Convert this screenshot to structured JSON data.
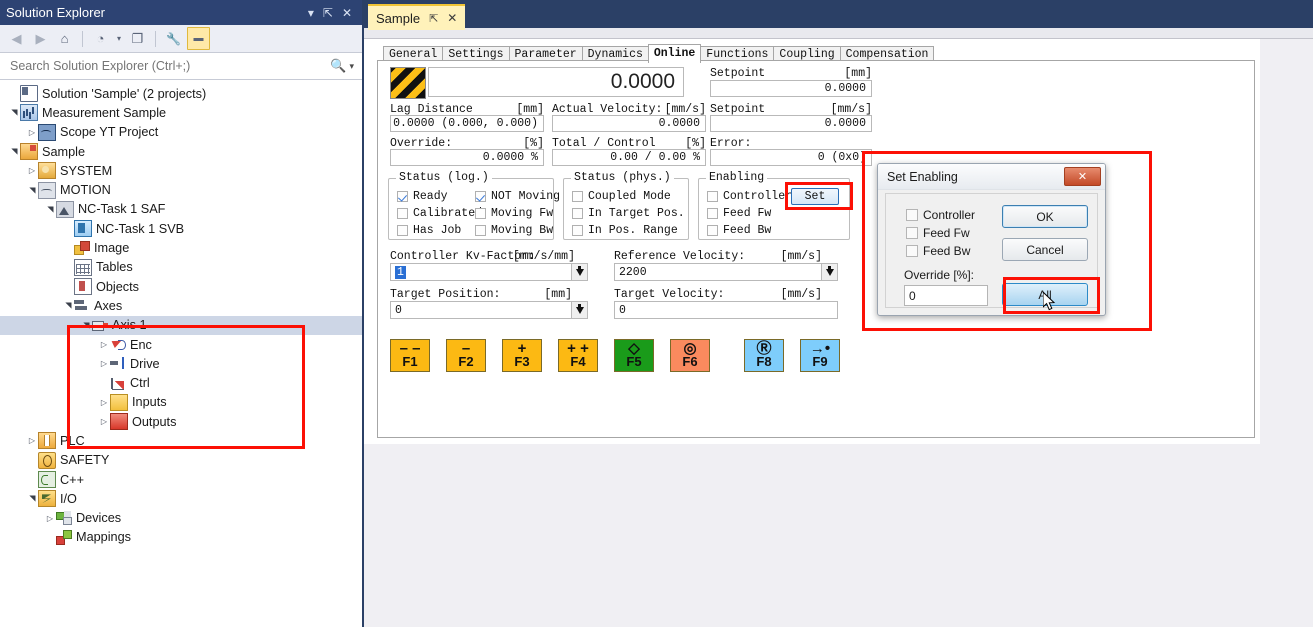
{
  "solution_explorer": {
    "title": "Solution Explorer",
    "titlebar_buttons": [
      {
        "name": "dropdown",
        "glyph": "▾"
      },
      {
        "name": "pin",
        "glyph": "⇱"
      },
      {
        "name": "close",
        "glyph": "✕"
      }
    ],
    "toolbar": [
      {
        "name": "back-icon",
        "glyph": "◀"
      },
      {
        "name": "forward-icon",
        "glyph": "▶"
      },
      {
        "name": "home-icon",
        "glyph": "⌂"
      },
      {
        "name": "pending-changes-icon",
        "glyph": "◔"
      },
      {
        "name": "dropdown-icon",
        "glyph": "▾"
      },
      {
        "name": "copy-icon",
        "glyph": "❐"
      },
      {
        "name": "properties-icon",
        "glyph": "🔧"
      },
      {
        "name": "collapse-icon",
        "glyph": "▬"
      }
    ],
    "search": {
      "placeholder": "Search Solution Explorer (Ctrl+;)",
      "value": ""
    },
    "tree": [
      {
        "label": "Solution 'Sample' (2 projects)",
        "depth": 0,
        "expander": "",
        "icon": "i-sln"
      },
      {
        "label": "Measurement Sample",
        "depth": 0,
        "expander": "open",
        "icon": "i-meas"
      },
      {
        "label": "Scope YT Project",
        "depth": 1,
        "expander": "closed",
        "icon": "i-scope"
      },
      {
        "label": "Sample",
        "depth": 0,
        "expander": "open",
        "icon": "i-sample"
      },
      {
        "label": "SYSTEM",
        "depth": 1,
        "expander": "closed",
        "icon": "i-system"
      },
      {
        "label": "MOTION",
        "depth": 1,
        "expander": "open",
        "icon": "i-motion"
      },
      {
        "label": "NC-Task 1 SAF",
        "depth": 2,
        "expander": "open",
        "icon": "i-saf"
      },
      {
        "label": "NC-Task 1 SVB",
        "depth": 3,
        "expander": "",
        "icon": "i-svb"
      },
      {
        "label": "Image",
        "depth": 3,
        "expander": "",
        "icon": "i-image"
      },
      {
        "label": "Tables",
        "depth": 3,
        "expander": "",
        "icon": "i-tables"
      },
      {
        "label": "Objects",
        "depth": 3,
        "expander": "",
        "icon": "i-objects"
      },
      {
        "label": "Axes",
        "depth": 3,
        "expander": "open",
        "icon": "i-axes"
      },
      {
        "label": "Axis 1",
        "depth": 4,
        "expander": "open",
        "icon": "i-axis",
        "selected": true
      },
      {
        "label": "Enc",
        "depth": 5,
        "expander": "closed",
        "icon": "i-enc"
      },
      {
        "label": "Drive",
        "depth": 5,
        "expander": "closed",
        "icon": "i-drive"
      },
      {
        "label": "Ctrl",
        "depth": 5,
        "expander": "",
        "icon": "i-ctrl"
      },
      {
        "label": "Inputs",
        "depth": 5,
        "expander": "closed",
        "icon": "i-inputs"
      },
      {
        "label": "Outputs",
        "depth": 5,
        "expander": "closed",
        "icon": "i-outputs"
      },
      {
        "label": "PLC",
        "depth": 1,
        "expander": "closed",
        "icon": "i-plc"
      },
      {
        "label": "SAFETY",
        "depth": 1,
        "expander": "",
        "icon": "i-safety"
      },
      {
        "label": "C++",
        "depth": 1,
        "expander": "",
        "icon": "i-cpp"
      },
      {
        "label": "I/O",
        "depth": 1,
        "expander": "open",
        "icon": "i-io"
      },
      {
        "label": "Devices",
        "depth": 2,
        "expander": "closed",
        "icon": "i-devices"
      },
      {
        "label": "Mappings",
        "depth": 2,
        "expander": "",
        "icon": "i-mappings"
      }
    ]
  },
  "document": {
    "tab": {
      "title": "Sample",
      "pin_glyph": "⇱",
      "close_glyph": "✕"
    },
    "tabs": [
      {
        "label": "General",
        "active": false
      },
      {
        "label": "Settings",
        "active": false
      },
      {
        "label": "Parameter",
        "active": false
      },
      {
        "label": "Dynamics",
        "active": false
      },
      {
        "label": "Online",
        "active": true
      },
      {
        "label": "Functions",
        "active": false
      },
      {
        "label": "Coupling",
        "active": false
      },
      {
        "label": "Compensation",
        "active": false
      }
    ]
  },
  "online": {
    "position_value": "0.0000",
    "readouts": {
      "lag_distance_label": "Lag Distance",
      "lag_distance_unit": "[mm]",
      "lag_distance_value": "0.0000   (0.000,  0.000)",
      "actual_velocity_label": "Actual Velocity:",
      "actual_velocity_unit": "[mm/s]",
      "actual_velocity_value": "0.0000",
      "setpoint_pos_label": "Setpoint",
      "setpoint_pos_unit": "[mm]",
      "setpoint_pos_value": "0.0000",
      "setpoint_vel_label": "Setpoint",
      "setpoint_vel_unit": "[mm/s]",
      "setpoint_vel_value": "0.0000",
      "override_label": "Override:",
      "override_unit": "[%]",
      "override_value": "0.0000 %",
      "total_control_label": "Total / Control",
      "total_control_unit": "[%]",
      "total_control_value": "0.00 /   0.00 %",
      "error_label": "Error:",
      "error_value": "0  (0x0)"
    },
    "status_log": {
      "title": "Status (log.)",
      "items": [
        {
          "label": "Ready",
          "checked": true
        },
        {
          "label": "NOT Moving",
          "checked": true
        },
        {
          "label": "Calibrated",
          "checked": false
        },
        {
          "label": "Moving Fw",
          "checked": false
        },
        {
          "label": "Has Job",
          "checked": false
        },
        {
          "label": "Moving Bw",
          "checked": false
        }
      ]
    },
    "status_phys": {
      "title": "Status (phys.)",
      "items": [
        {
          "label": "Coupled Mode",
          "checked": false
        },
        {
          "label": "In Target Pos.",
          "checked": false
        },
        {
          "label": "In Pos. Range",
          "checked": false
        }
      ]
    },
    "enabling": {
      "title": "Enabling",
      "items": [
        {
          "label": "Controller",
          "checked": false
        },
        {
          "label": "Feed Fw",
          "checked": false
        },
        {
          "label": "Feed Bw",
          "checked": false
        }
      ],
      "set_button": "Set"
    },
    "inputs": {
      "kv_factor_label": "Controller Kv-Factor:",
      "kv_factor_unit": "[mm/s/mm]",
      "kv_factor_value": "1",
      "reference_velocity_label": "Reference Velocity:",
      "reference_velocity_unit": "[mm/s]",
      "reference_velocity_value": "2200",
      "target_position_label": "Target Position:",
      "target_position_unit": "[mm]",
      "target_position_value": "0",
      "target_velocity_label": "Target Velocity:",
      "target_velocity_unit": "[mm/s]",
      "target_velocity_value": "0"
    },
    "fkeys": [
      {
        "key": "F1",
        "symbol": "– –",
        "color": "#fcb913"
      },
      {
        "key": "F2",
        "symbol": "–",
        "color": "#fcb913"
      },
      {
        "key": "F3",
        "symbol": "+",
        "color": "#fcb913"
      },
      {
        "key": "F4",
        "symbol": "+ +",
        "color": "#fcb913"
      },
      {
        "key": "F5",
        "symbol": "◇",
        "color": "#1a9b1a"
      },
      {
        "key": "F6",
        "symbol": "◎",
        "color": "#fa8a5e"
      },
      {
        "key": "F8",
        "symbol": "Ⓡ",
        "color": "#7ecdfb"
      },
      {
        "key": "F9",
        "symbol": "→•",
        "color": "#7ecdfb"
      }
    ]
  },
  "dialog": {
    "title": "Set Enabling",
    "close_glyph": "✕",
    "checkboxes": [
      {
        "label": "Controller",
        "checked": false
      },
      {
        "label": "Feed Fw",
        "checked": false
      },
      {
        "label": "Feed Bw",
        "checked": false
      }
    ],
    "override_label": "Override [%]:",
    "override_value": "0",
    "buttons": [
      {
        "label": "OK",
        "state": "focus"
      },
      {
        "label": "Cancel",
        "state": "normal"
      },
      {
        "label": "All",
        "state": "hover"
      }
    ]
  },
  "annotations": {
    "color": "#fc1005",
    "boxes": [
      "tree-axis1-region",
      "enabling-set-button",
      "set-enabling-dialog",
      "dialog-all-button"
    ]
  }
}
